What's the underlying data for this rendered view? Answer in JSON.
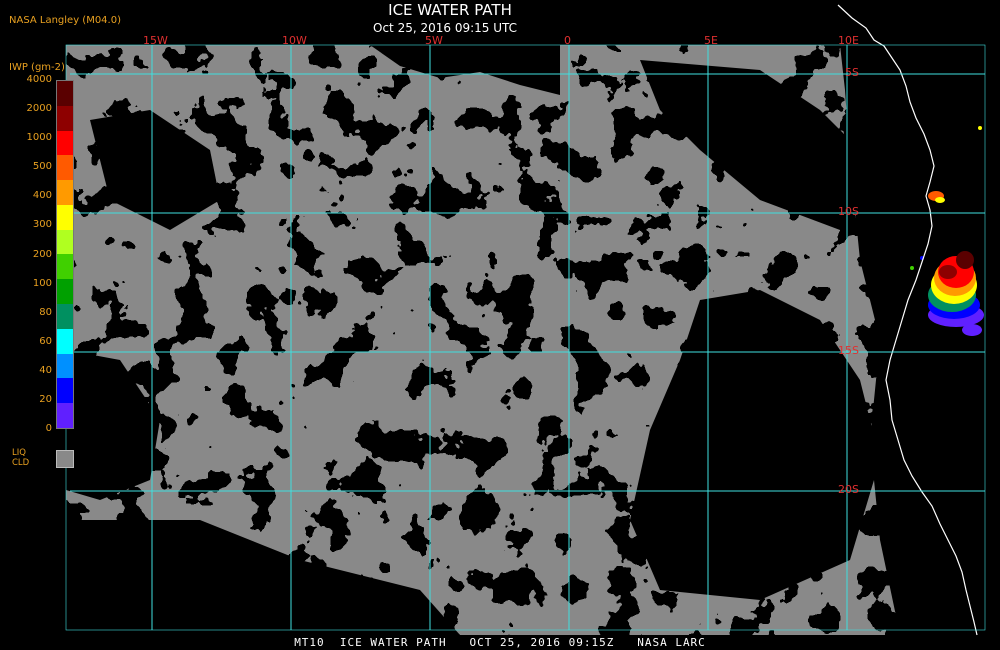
{
  "header": {
    "producer": "NASA Langley (M04.0)",
    "title": "ICE WATER PATH",
    "subtitle": "Oct 25, 2016 09:15 UTC"
  },
  "footer": {
    "caption": "MT10  ICE WATER PATH   OCT 25, 2016 09:15Z   NASA LARC"
  },
  "legend": {
    "unit": "IWP (gm-2)",
    "ticks": [
      "4000",
      "2000",
      "1000",
      "500",
      "400",
      "300",
      "200",
      "100",
      "80",
      "60",
      "40",
      "20",
      "0"
    ],
    "colors": [
      "#5a0000",
      "#8e0000",
      "#ff0000",
      "#ff5a00",
      "#ff9a00",
      "#ffff00",
      "#b0ff20",
      "#40d000",
      "#00a000",
      "#009060",
      "#00ffff",
      "#0090ff",
      "#0000ff",
      "#6020ff"
    ],
    "liquid_label": [
      "LIQ",
      "CLD"
    ],
    "liquid_color": "#898989"
  },
  "map": {
    "longitude_labels": [
      "15W",
      "10W",
      "5W",
      "0",
      "5E",
      "10E"
    ],
    "latitude_labels": [
      "5S",
      "10S",
      "15S",
      "20S"
    ],
    "colors": {
      "background": "#000000",
      "cloud": "#898989",
      "grid": "#40e0e0",
      "coast": "#ffffff",
      "grid_label": "#e03030",
      "header_text": "#e8a020"
    }
  }
}
